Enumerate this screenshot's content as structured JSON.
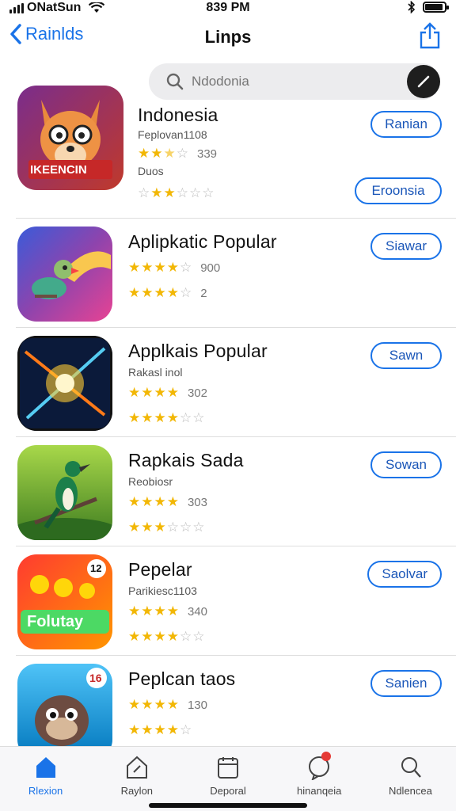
{
  "status": {
    "carrier": "ONatSun",
    "time": "839 PM"
  },
  "nav": {
    "back_label": "Rainlds",
    "title": "Linps"
  },
  "search": {
    "placeholder": "Ndodonia"
  },
  "apps": [
    {
      "name": "Indonesia",
      "sub": "Feplovan1108",
      "rating": "339",
      "extra": "Duos",
      "button": "Ranian",
      "button2": "Eroonsia",
      "icon_text": "IKEENCIN",
      "stars1": 2.5,
      "stars2": 2
    },
    {
      "name": "Aplipkatic Popular",
      "sub": "",
      "rating": "900",
      "button": "Siawar",
      "stars1": 3.5,
      "stars2": 3.5,
      "rating2": "2"
    },
    {
      "name": "Applkais Popular",
      "sub": "Rakasl inol",
      "rating": "302",
      "button": "Sawn",
      "stars1": 4,
      "stars2": 3
    },
    {
      "name": "Rapkais Sada",
      "sub": "Reobiosr",
      "rating": "303",
      "button": "Sowan",
      "stars1": 4,
      "stars2": 2.5
    },
    {
      "name": "Pepelar",
      "sub": "Parikiesc1103",
      "rating": "340",
      "button": "Saolvar",
      "stars1": 4,
      "stars2": 3,
      "icon_text": "Folutay",
      "badge": "12"
    },
    {
      "name": "Peplcan taos",
      "sub": "",
      "rating": "130",
      "button": "Sanien",
      "stars1": 4,
      "stars2": 4,
      "badge": "16"
    }
  ],
  "tabs": [
    {
      "label": "Rlexion",
      "icon": "home-icon",
      "active": true
    },
    {
      "label": "Raylon",
      "icon": "house-outline-icon"
    },
    {
      "label": "Deporal",
      "icon": "calendar-icon"
    },
    {
      "label": "hinanqeia",
      "icon": "chat-icon"
    },
    {
      "label": "Ndlencea",
      "icon": "person-icon"
    }
  ],
  "colors": {
    "accent": "#1a73e8",
    "star": "#f2b705"
  }
}
